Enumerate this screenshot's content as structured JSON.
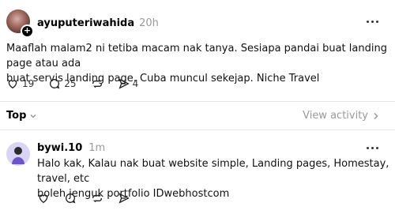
{
  "post": {
    "username": "ayuputeriwahida",
    "time": "20h",
    "text_line1": "Maaflah malam2 ni tetiba macam nak tanya. Sesiapa pandai buat landing page atau ada",
    "text_line2": "buat servis landing page. Cuba muncul sekejap. Niche Travel",
    "likes": "19",
    "replies": "25",
    "shares": "4"
  },
  "sort": {
    "label": "Top",
    "view_activity": "View activity"
  },
  "reply": {
    "username": "bywi.10",
    "time": "1m",
    "text_line1": "Halo kak, Kalau nak buat website simple, Landing pages, Homestay, travel, etc",
    "text_line2": "boleh jenguk portfolio IDwebhostcom"
  },
  "colors": {
    "muted": "#9a9a9a",
    "divider": "#e6e6e6",
    "text": "#111111"
  }
}
